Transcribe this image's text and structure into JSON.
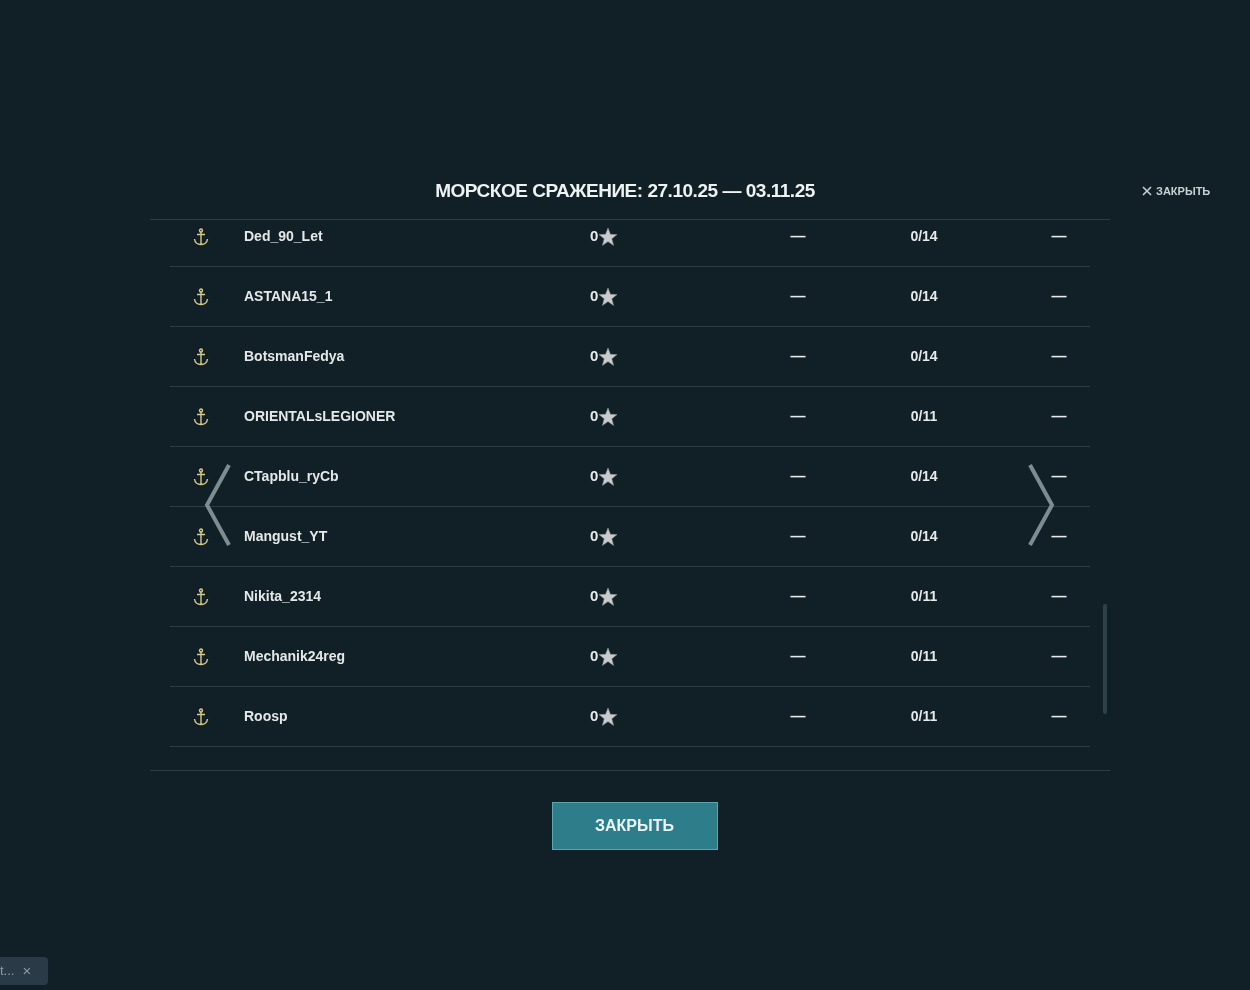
{
  "dialog": {
    "title": "МОРСКОЕ СРАЖЕНИЕ: 27.10.25 — 03.11.25",
    "close_link": "ЗАКРЫТЬ",
    "close_button": "ЗАКРЫТЬ"
  },
  "rows": [
    {
      "name": "Ded_90_Let",
      "score": "0",
      "column_3": "—",
      "column_4": "0/14",
      "column_5": "—"
    },
    {
      "name": "ASTANA15_1",
      "score": "0",
      "column_3": "—",
      "column_4": "0/14",
      "column_5": "—"
    },
    {
      "name": "BotsmanFedya",
      "score": "0",
      "column_3": "—",
      "column_4": "0/14",
      "column_5": "—"
    },
    {
      "name": "ORIENTALsLEGIONER",
      "score": "0",
      "column_3": "—",
      "column_4": "0/11",
      "column_5": "—"
    },
    {
      "name": "CTapblu_ryCb",
      "score": "0",
      "column_3": "—",
      "column_4": "0/14",
      "column_5": "—"
    },
    {
      "name": "Mangust_YT",
      "score": "0",
      "column_3": "—",
      "column_4": "0/14",
      "column_5": "—"
    },
    {
      "name": "Nikita_2314",
      "score": "0",
      "column_3": "—",
      "column_4": "0/11",
      "column_5": "—"
    },
    {
      "name": "Mechanik24reg",
      "score": "0",
      "column_3": "—",
      "column_4": "0/11",
      "column_5": "—"
    },
    {
      "name": "Roosp",
      "score": "0",
      "column_3": "—",
      "column_4": "0/11",
      "column_5": "—"
    }
  ],
  "toast": {
    "text": "t...",
    "close": "×"
  }
}
